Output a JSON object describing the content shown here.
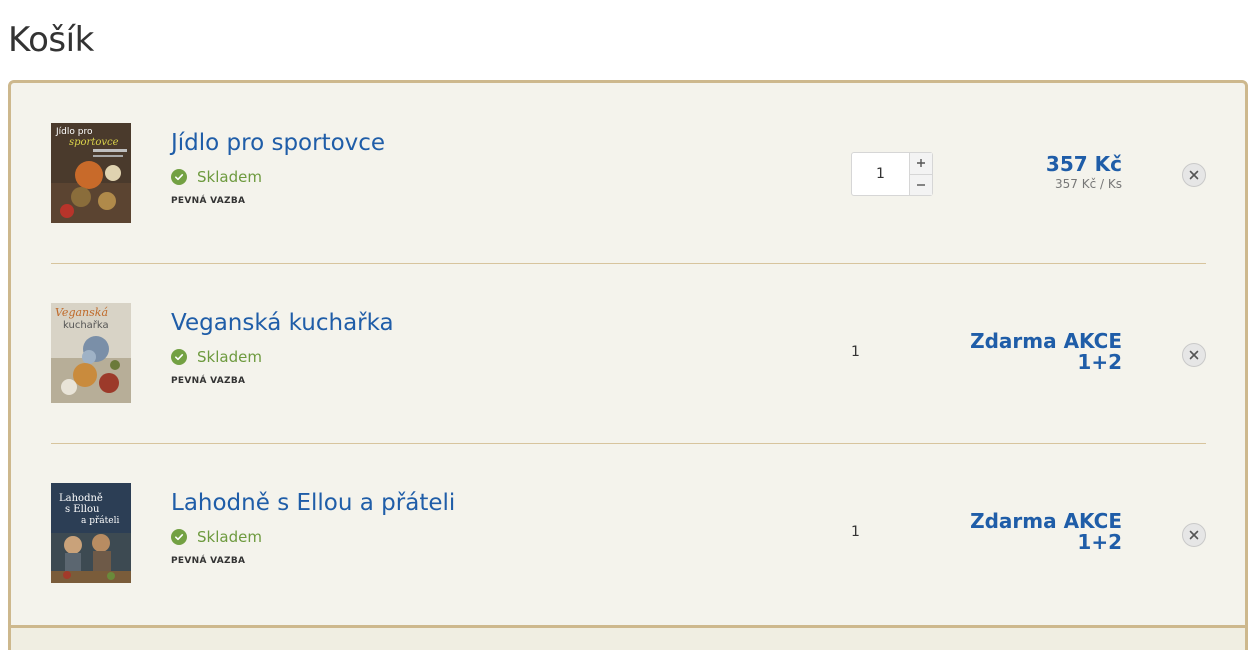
{
  "page": {
    "title": "Košík"
  },
  "cart": {
    "items": [
      {
        "title": "Jídlo pro sportovce",
        "cover_text": "Jídlo pro sportovce",
        "stock": "Skladem",
        "binding": "PEVNÁ VAZBA",
        "quantity": "1",
        "price": "357 Kč",
        "unit_price": "357 Kč / Ks"
      },
      {
        "title": "Veganská kuchařka",
        "cover_text": "Veganská kuchařka",
        "stock": "Skladem",
        "binding": "PEVNÁ VAZBA",
        "quantity": "1",
        "promo_line1": "Zdarma AKCE",
        "promo_line2": "1+2"
      },
      {
        "title": "Lahodně s Ellou a přáteli",
        "cover_text": "Lahodně s Ellou a přáteli",
        "stock": "Skladem",
        "binding": "PEVNÁ VAZBA",
        "quantity": "1",
        "promo_line1": "Zdarma AKCE",
        "promo_line2": "1+2"
      }
    ]
  },
  "icons": {
    "stock": "check-circle-icon",
    "remove": "close-icon",
    "increase": "plus",
    "decrease": "minus"
  },
  "colors": {
    "link": "#1f5da8",
    "stock": "#6d9a3e",
    "border": "#cdb88d",
    "panel": "#f4f3ec"
  }
}
